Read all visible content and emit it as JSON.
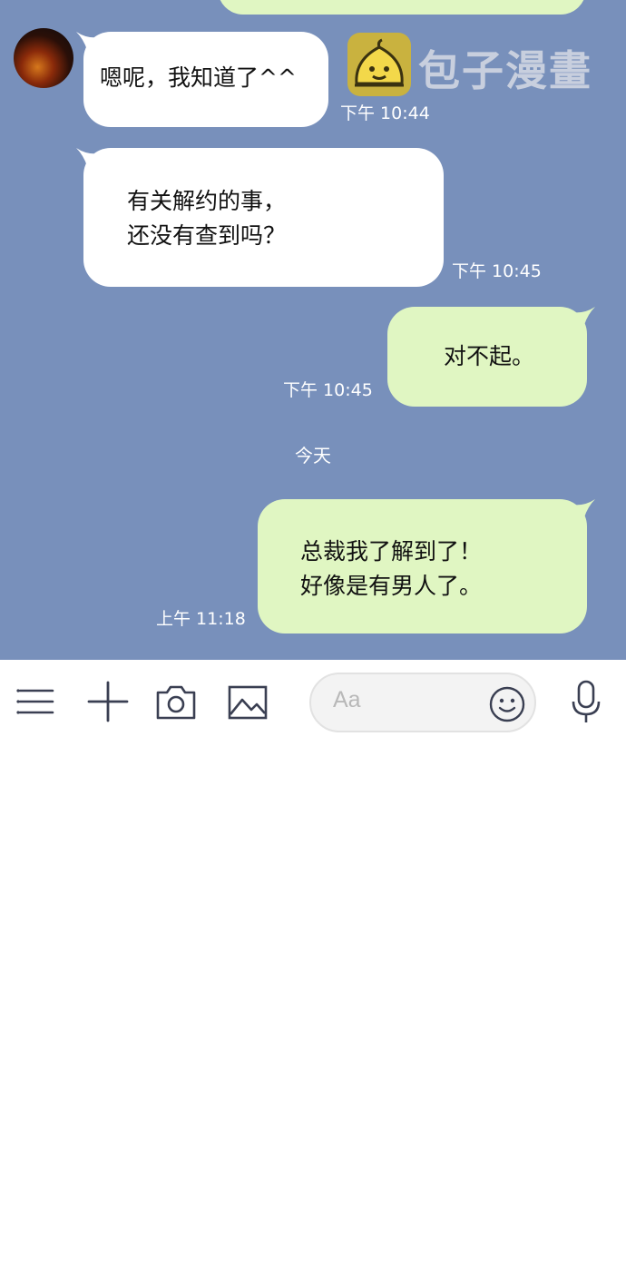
{
  "watermark": {
    "text": "包子漫畫"
  },
  "messages": [
    {
      "side": "in",
      "lines": [
        "嗯呢，我知道了^^"
      ],
      "time": "下午 10:44"
    },
    {
      "side": "in",
      "lines": [
        "有关解约的事，",
        "还没有查到吗？"
      ],
      "time": "下午 10:45"
    },
    {
      "side": "out",
      "lines": [
        "对不起。"
      ],
      "time": "下午 10:45"
    },
    {
      "side": "out",
      "lines": [
        "总裁我了解到了！",
        "好像是有男人了。"
      ],
      "time": "上午 11:18"
    }
  ],
  "divider": "今天",
  "input": {
    "placeholder": "Aa"
  },
  "icons": {
    "menu": "menu-icon",
    "plus": "plus-icon",
    "camera": "camera-icon",
    "image": "image-icon",
    "emoji": "emoji-icon",
    "mic": "microphone-icon"
  },
  "colors": {
    "chat_bg": "#7890bb",
    "incoming_bubble": "#ffffff",
    "outgoing_bubble": "#e0f6c2"
  }
}
